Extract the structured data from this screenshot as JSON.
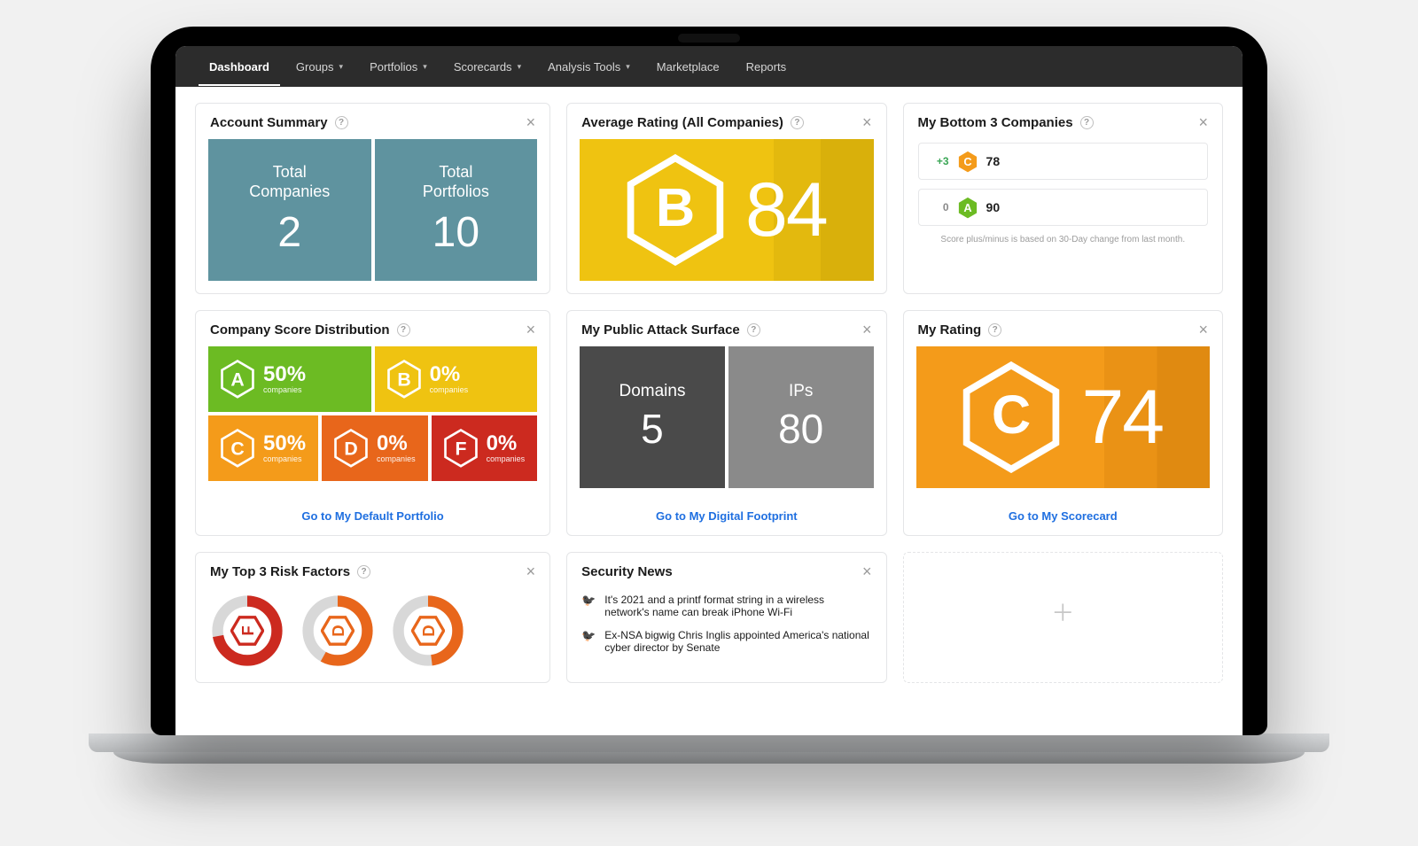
{
  "nav": {
    "items": [
      {
        "label": "Dashboard",
        "dropdown": false,
        "active": true
      },
      {
        "label": "Groups",
        "dropdown": true,
        "active": false
      },
      {
        "label": "Portfolios",
        "dropdown": true,
        "active": false
      },
      {
        "label": "Scorecards",
        "dropdown": true,
        "active": false
      },
      {
        "label": "Analysis Tools",
        "dropdown": true,
        "active": false
      },
      {
        "label": "Marketplace",
        "dropdown": false,
        "active": false
      },
      {
        "label": "Reports",
        "dropdown": false,
        "active": false
      }
    ]
  },
  "accountSummary": {
    "title": "Account Summary",
    "tiles": [
      {
        "label_line1": "Total",
        "label_line2": "Companies",
        "value": "2"
      },
      {
        "label_line1": "Total",
        "label_line2": "Portfolios",
        "value": "10"
      }
    ]
  },
  "averageRating": {
    "title": "Average Rating (All Companies)",
    "grade": "B",
    "score": "84",
    "color": "#efc311"
  },
  "bottomCompanies": {
    "title": "My Bottom 3 Companies",
    "rows": [
      {
        "delta": "+3",
        "delta_class": "up",
        "grade": "C",
        "grade_color": "#f49b1a",
        "score": "78"
      },
      {
        "delta": "0",
        "delta_class": "zero",
        "grade": "A",
        "grade_color": "#6cbb23",
        "score": "90"
      }
    ],
    "footnote": "Score plus/minus is based on 30-Day change from last month."
  },
  "distribution": {
    "title": "Company Score Distribution",
    "cells": [
      {
        "grade": "A",
        "pct": "50%",
        "sub": "companies",
        "bg": "bg-green"
      },
      {
        "grade": "B",
        "pct": "0%",
        "sub": "companies",
        "bg": "bg-yellow"
      },
      {
        "grade": "C",
        "pct": "50%",
        "sub": "companies",
        "bg": "bg-orange"
      },
      {
        "grade": "D",
        "pct": "0%",
        "sub": "companies",
        "bg": "bg-darkorange"
      },
      {
        "grade": "F",
        "pct": "0%",
        "sub": "companies",
        "bg": "bg-red"
      }
    ],
    "link": "Go to My Default Portfolio"
  },
  "attackSurface": {
    "title": "My Public Attack Surface",
    "tiles": [
      {
        "label": "Domains",
        "value": "5"
      },
      {
        "label": "IPs",
        "value": "80"
      }
    ],
    "link": "Go to My Digital Footprint"
  },
  "myRating": {
    "title": "My Rating",
    "grade": "C",
    "score": "74",
    "color": "#f49b1a",
    "link": "Go to My Scorecard"
  },
  "riskFactors": {
    "title": "My Top 3 Risk Factors",
    "donuts": [
      {
        "grade": "F",
        "color": "#cc2a1f",
        "pct": 72
      },
      {
        "grade": "D",
        "color": "#e8661b",
        "pct": 58
      },
      {
        "grade": "D",
        "color": "#e8661b",
        "pct": 48
      }
    ]
  },
  "news": {
    "title": "Security News",
    "items": [
      "It's 2021 and a printf format string in a wireless network's name can break iPhone Wi-Fi",
      "Ex-NSA bigwig Chris Inglis appointed America's national cyber director by Senate"
    ]
  },
  "chart_data": [
    {
      "type": "bar",
      "title": "Company Score Distribution",
      "categories": [
        "A",
        "B",
        "C",
        "D",
        "F"
      ],
      "values": [
        50,
        0,
        50,
        0,
        0
      ],
      "ylabel": "% companies",
      "ylim": [
        0,
        100
      ]
    },
    {
      "type": "pie",
      "title": "My Top 3 Risk Factors (donut fill %)",
      "series": [
        {
          "name": "F",
          "values": [
            72
          ]
        },
        {
          "name": "D",
          "values": [
            58
          ]
        },
        {
          "name": "D",
          "values": [
            48
          ]
        }
      ]
    }
  ]
}
